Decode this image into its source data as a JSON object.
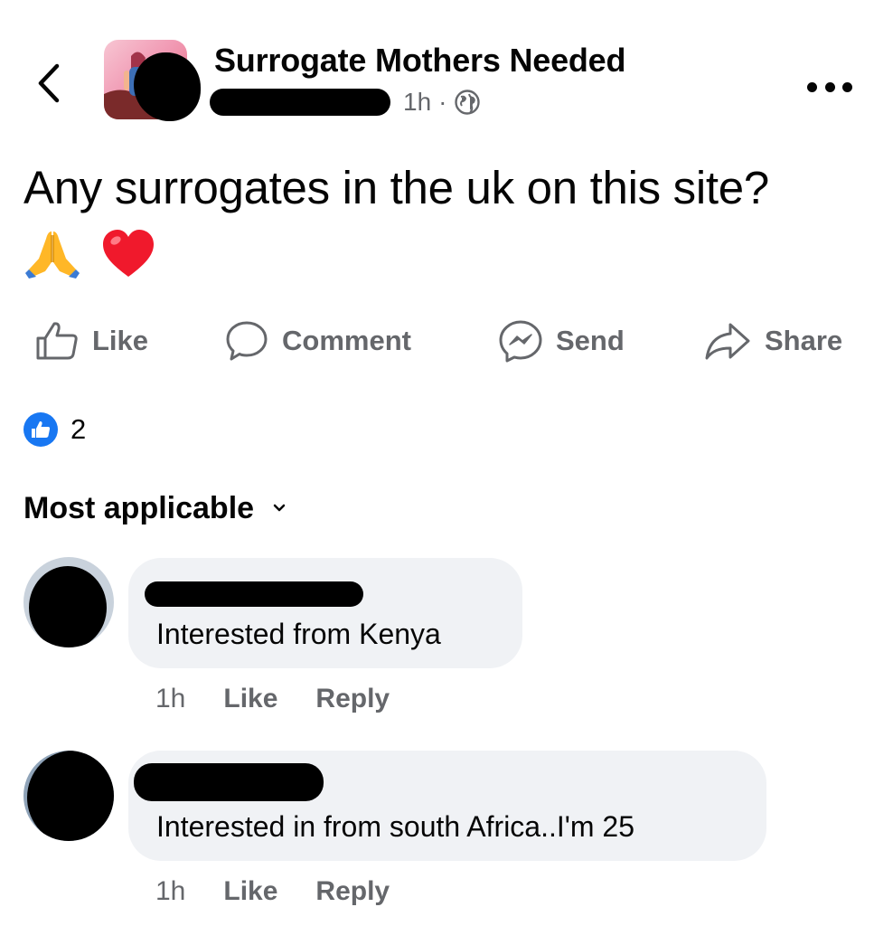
{
  "header": {
    "group_name": "Surrogate Mothers Needed",
    "time": "1h",
    "separator": "·",
    "privacy_icon": "globe-icon",
    "back_icon": "chevron-left-icon",
    "more_icon": "more-dots-icon"
  },
  "post": {
    "text": "Any surrogates in the uk on this site?",
    "emojis": [
      "folded-hands-emoji",
      "red-heart-emoji"
    ]
  },
  "actions": {
    "like": "Like",
    "comment": "Comment",
    "send": "Send",
    "share": "Share"
  },
  "reactions": {
    "count": "2",
    "icon": "like-reaction-icon"
  },
  "sort": {
    "label": "Most applicable",
    "icon": "chevron-down-icon"
  },
  "comments": [
    {
      "text": "Interested from Kenya",
      "time": "1h",
      "like_label": "Like",
      "reply_label": "Reply"
    },
    {
      "text": "Interested in from south Africa..I'm 25",
      "time": "1h",
      "like_label": "Like",
      "reply_label": "Reply"
    }
  ],
  "colors": {
    "primary_text": "#050505",
    "secondary_text": "#65676b",
    "bubble_bg": "#f0f2f5",
    "accent_blue": "#1877f2"
  }
}
